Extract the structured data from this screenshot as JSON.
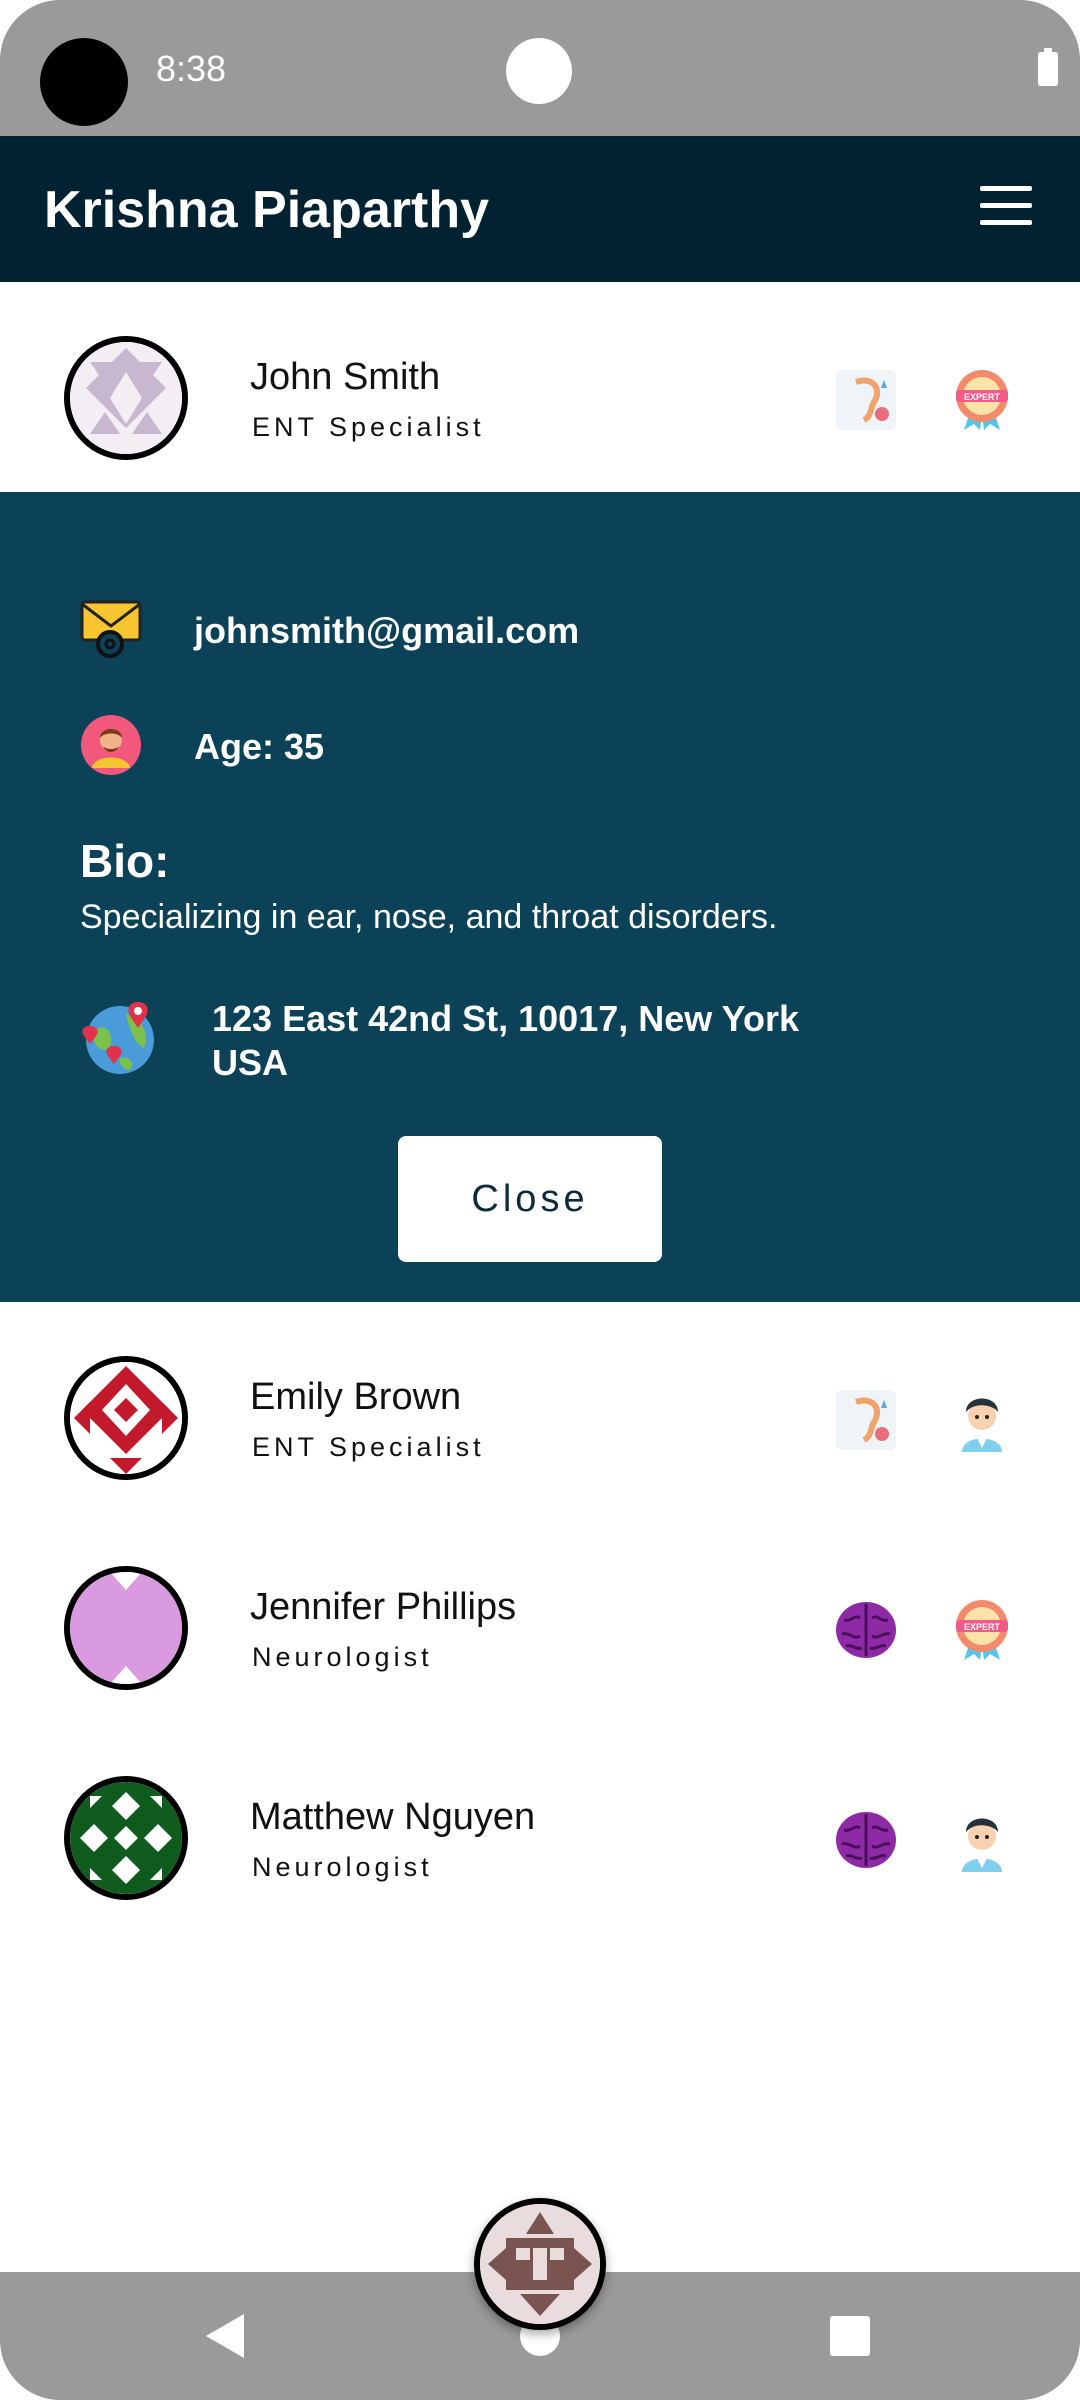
{
  "status_bar": {
    "time": "8:38"
  },
  "app_bar": {
    "title": "Krishna Piaparthy",
    "menu_icon": "hamburger-menu-icon"
  },
  "doctors": [
    {
      "name": "John Smith",
      "specialty": "ENT Specialist",
      "avatar_color": "#c7b7cf",
      "badges": [
        "ear-icon",
        "expert-badge-icon"
      ]
    },
    {
      "name": "Emily Brown",
      "specialty": "ENT Specialist",
      "avatar_color": "#c2192c",
      "badges": [
        "ear-icon",
        "doctor-avatar-icon"
      ]
    },
    {
      "name": "Jennifer Phillips",
      "specialty": "Neurologist",
      "avatar_color": "#d99adf",
      "badges": [
        "brain-icon",
        "expert-badge-icon"
      ]
    },
    {
      "name": "Matthew Nguyen",
      "specialty": "Neurologist",
      "avatar_color": "#0f5c1e",
      "badges": [
        "brain-icon",
        "doctor-avatar-icon"
      ]
    }
  ],
  "details": {
    "email": "johnsmith@gmail.com",
    "age": "Age: 35",
    "bio_label": "Bio:",
    "bio": "Specializing in ear, nose, and throat disorders.",
    "address_line1": "123 East 42nd St, 10017, New York",
    "address_line2": "USA",
    "close_label": "Close"
  },
  "colors": {
    "app_bar": "#022232",
    "details_bg": "#0b4258",
    "system_bar": "#9a9a9a"
  }
}
